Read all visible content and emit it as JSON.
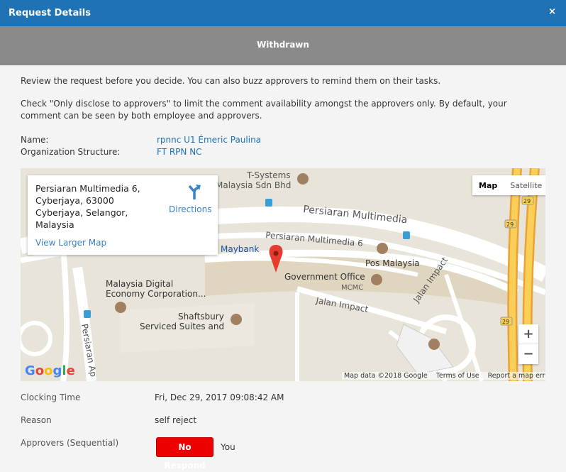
{
  "dialog": {
    "title": "Request Details",
    "close": "×"
  },
  "status": "Withdrawn",
  "intro": {
    "para1": "Review the request before you decide. You can also buzz approvers to remind them on their tasks.",
    "para2": "Check \"Only disclose to approvers\" to limit the comment availability amongst the approvers only. By default, your comment can be seen by both employee and approvers."
  },
  "fields": {
    "name_label": "Name:",
    "name_value": "rpnnc U1 Émeric Paulina",
    "org_label": "Organization Structure:",
    "org_value": "FT RPN NC"
  },
  "map": {
    "address_lines": [
      "Persiaran Multimedia 6,",
      "Cyberjaya, 63000",
      "Cyberjaya, Selangor,",
      "Malaysia"
    ],
    "directions": "Directions",
    "view_larger": "View Larger Map",
    "type_map": "Map",
    "type_satellite": "Satellite",
    "zoom_in": "+",
    "zoom_out": "−",
    "logo": "Google",
    "attrib_data": "Map data ©2018 Google",
    "attrib_terms": "Terms of Use",
    "attrib_report": "Report a map error",
    "labels": {
      "tsystems1": "T-Systems",
      "tsystems2": "Malaysia Sdn Bhd",
      "persiaran_mm": "Persiaran Multimedia",
      "persiaran_mm6": "Persiaran Multimedia 6",
      "maybank": "Maybank",
      "pos": "Pos Malaysia",
      "govoffice": "Government Office",
      "mcmc": "MCMC",
      "mdec1": "Malaysia Digital",
      "mdec2": "Economy Corporation...",
      "shafts1": "Shaftsbury",
      "shafts2": "Serviced Suites and",
      "jalan_impact": "Jalan Impact",
      "jalan_impact2": "Jalan Impact",
      "persiaran_ap": "Persiaran Ap",
      "route29": "29"
    }
  },
  "details": {
    "clocking_label": "Clocking Time",
    "clocking_value": "Fri, Dec 29, 2017 09:08:42 AM",
    "reason_label": "Reason",
    "reason_value": "self reject",
    "approvers_label": "Approvers (Sequential)",
    "approver_status": "No Respond",
    "approver_name": "You"
  },
  "colors": {
    "titlebar": "#1f72b3",
    "statusbar": "#8a8a8a",
    "link": "#1f72b3",
    "badge": "#ee0000"
  }
}
